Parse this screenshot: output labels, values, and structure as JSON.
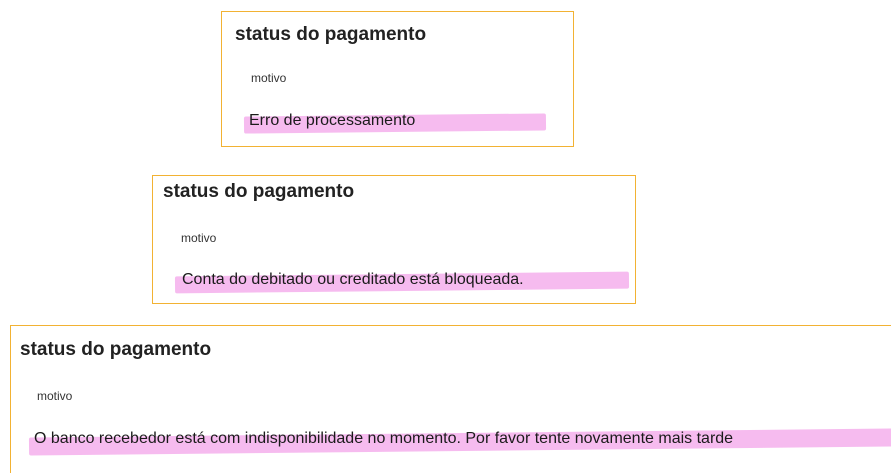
{
  "cards": [
    {
      "title": "status do pagamento",
      "subtitle": "motivo",
      "reason": "Erro de processamento"
    },
    {
      "title": "status do pagamento",
      "subtitle": "motivo",
      "reason": "Conta do debitado ou creditado está bloqueada."
    },
    {
      "title": "status do pagamento",
      "subtitle": "motivo",
      "reason": "O banco recebedor está com indisponibilidade no momento. Por favor tente novamente mais tarde"
    }
  ],
  "colors": {
    "card_border": "#f2b233",
    "highlight": "#f5b7ee"
  }
}
